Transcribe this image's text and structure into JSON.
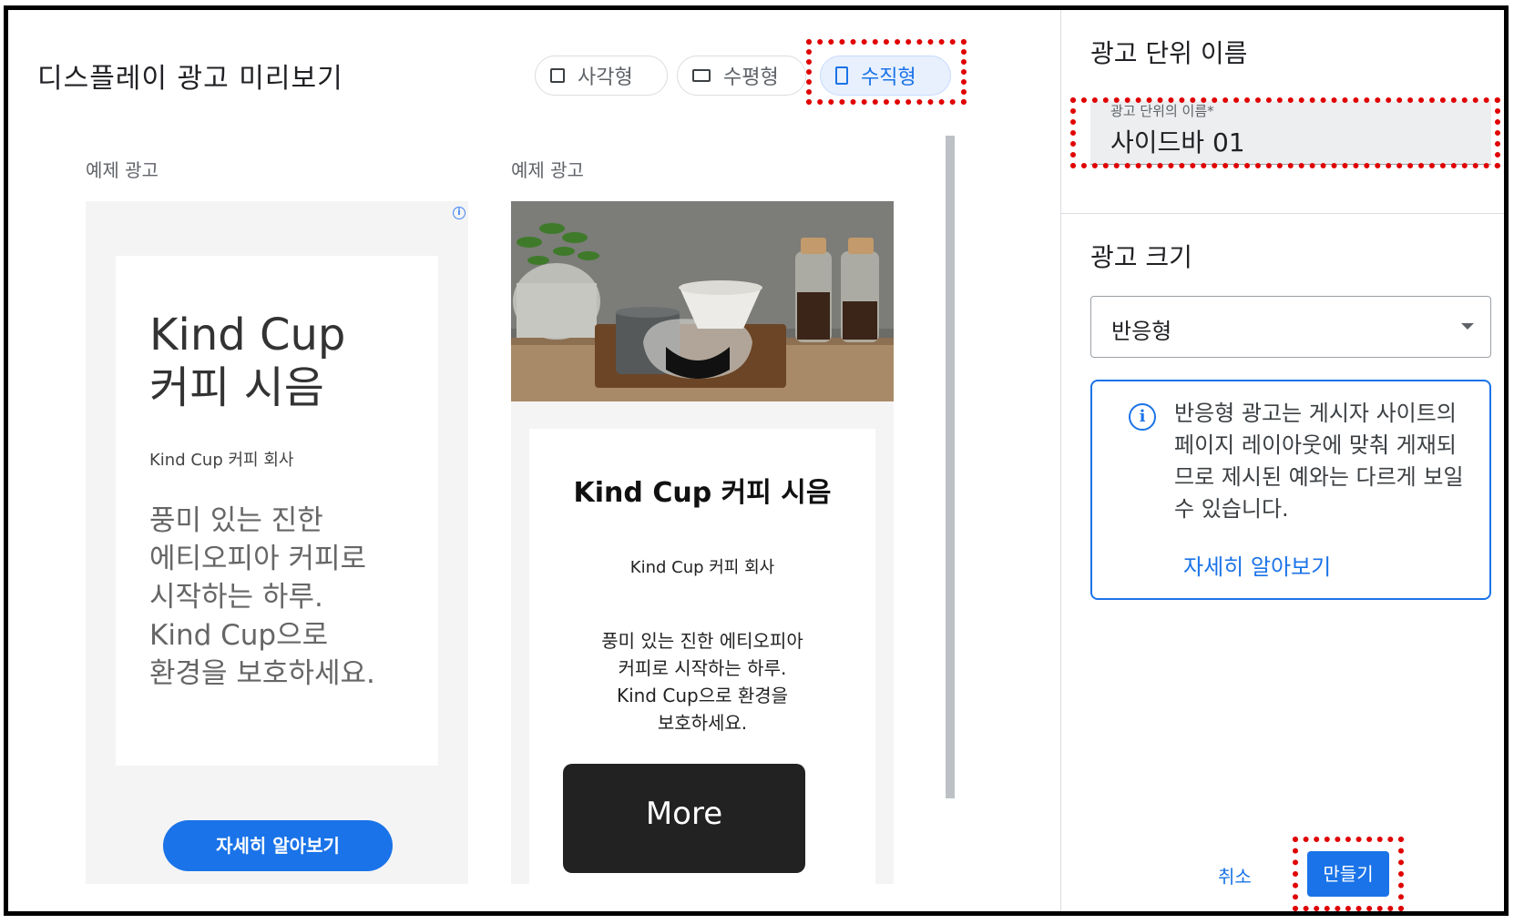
{
  "preview": {
    "title": "디스플레이 광고 미리보기",
    "format_chips": [
      {
        "label": "사각형",
        "icon": "square-icon",
        "selected": false
      },
      {
        "label": "수평형",
        "icon": "horizontal-rect-icon",
        "selected": false
      },
      {
        "label": "수직형",
        "icon": "vertical-rect-icon",
        "selected": true
      }
    ]
  },
  "sample_ads": [
    {
      "label": "예제 광고",
      "headline": "Kind Cup\n커피 시음",
      "company": "Kind Cup 커피 회사",
      "description": "풍미 있는 진한\n에티오피아 커피로\n시작하는 하루.\nKind Cup으로\n환경을 보호하세요.",
      "cta": "자세히 알아보기"
    },
    {
      "label": "예제 광고",
      "headline": "Kind Cup 커피 시음",
      "company": "Kind Cup 커피 회사",
      "description": "풍미 있는 진한 에티오피아\n커피로 시작하는 하루.\nKind Cup으로 환경을\n보호하세요.",
      "cta": "More"
    }
  ],
  "ad_unit": {
    "name_title": "광고 단위 이름",
    "name_field_label": "광고 단위의 이름*",
    "name_value": "사이드바 01",
    "size_title": "광고 크기",
    "size_value": "반응형",
    "notice_text": "반응형 광고는 게시자 사이트의 페이지 레이아웃에 맞춰 게재되므로 제시된 예와는 다르게 보일 수 있습니다.",
    "notice_link": "자세히 알아보기",
    "cancel_label": "취소",
    "create_label": "만들기"
  },
  "colors": {
    "accent": "#1a73e8",
    "highlight": "#e00000"
  }
}
